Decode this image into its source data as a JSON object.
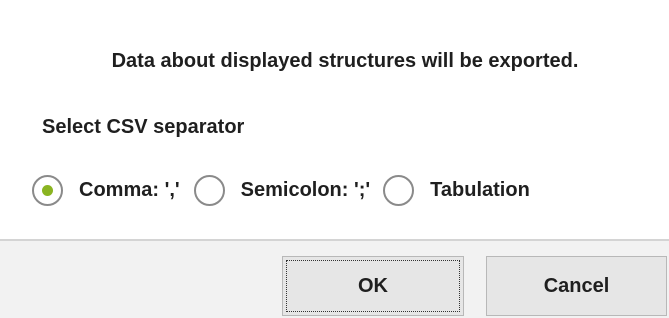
{
  "dialog": {
    "message": "Data about displayed structures will be exported.",
    "separator_label": "Select CSV separator",
    "options": [
      {
        "label": "Comma: ','",
        "checked": true
      },
      {
        "label": "Semicolon: ';'",
        "checked": false
      },
      {
        "label": "Tabulation",
        "checked": false
      }
    ],
    "buttons": {
      "ok": "OK",
      "cancel": "Cancel"
    }
  },
  "colors": {
    "radio_selected": "#8ab421",
    "footer_background": "#f2f2f2",
    "button_background": "#e6e6e6"
  },
  "icons": {
    "radio_checked": "radio-checked-icon",
    "radio_unchecked": "radio-unchecked-icon"
  }
}
